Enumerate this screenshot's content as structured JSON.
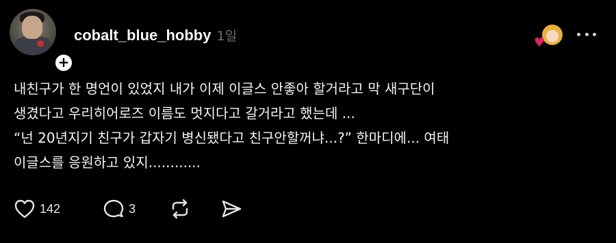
{
  "post": {
    "username": "cobalt_blue_hobby",
    "time": "1일",
    "follow_symbol": "+",
    "body_lines": [
      "내친구가 한 명언이 있었지 내가 이제 이글스 안좋아 할거라고 막 새구단이",
      "생겼다고 우리히어로즈 이름도 멋지다고 갈거라고 했는데 ...",
      "“넌 20년지기 친구가 갑자기 병신됐다고 친구안할꺼냐...?” 한마디에... 여태",
      "이글스를 응원하고 있지............"
    ]
  },
  "actions": {
    "like_count": "142",
    "comment_count": "3"
  },
  "icons": {
    "like": "heart-outline-icon",
    "comment": "comment-bubble-icon",
    "repost": "repost-arrows-icon",
    "share": "send-paper-plane-icon",
    "more": "more-dots-icon"
  },
  "colors": {
    "background": "#000000",
    "text": "#f3f5f7",
    "muted": "#6f6f6f",
    "heart_sticker": "#e0245e"
  }
}
